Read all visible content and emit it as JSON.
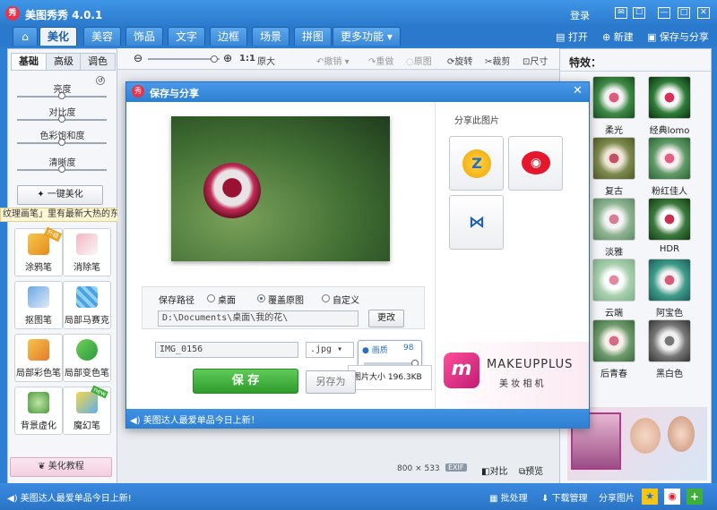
{
  "app": {
    "title": "美图秀秀 4.0.1",
    "logo_text": "秀",
    "login": "登录"
  },
  "window_controls": {
    "feedback": "✉",
    "menu": "☐",
    "minimize": "—",
    "maximize": "□",
    "close": "✕"
  },
  "tabs": [
    {
      "label": "⌂"
    },
    {
      "label": "美化"
    },
    {
      "label": "美容"
    },
    {
      "label": "饰品"
    },
    {
      "label": "文字"
    },
    {
      "label": "边框"
    },
    {
      "label": "场景"
    },
    {
      "label": "拼图"
    },
    {
      "label": "更多功能 ▾"
    }
  ],
  "top_actions": {
    "open": "打开",
    "new": "新建",
    "save_share": "保存与分享"
  },
  "left_panel": {
    "subtabs": [
      "基础",
      "高级",
      "调色"
    ],
    "sliders": [
      "亮度",
      "对比度",
      "色彩饱和度",
      "清晰度"
    ],
    "one_click": "一键美化",
    "marquee": "纹理画笔」里有最新大热的东北",
    "tools": [
      {
        "label": "涂鸦笔",
        "badge": "升级"
      },
      {
        "label": "消除笔",
        "badge": ""
      },
      {
        "label": "抠图笔",
        "badge": ""
      },
      {
        "label": "局部马赛克",
        "badge": ""
      },
      {
        "label": "局部彩色笔",
        "badge": ""
      },
      {
        "label": "局部变色笔",
        "badge": ""
      },
      {
        "label": "背景虚化",
        "badge": ""
      },
      {
        "label": "魔幻笔",
        "badge": "new"
      }
    ],
    "tutorial": "美化教程"
  },
  "toolbar": {
    "zoom_ratio": "1:1",
    "original_size": "原大",
    "undo": "撤销",
    "redo": "重做",
    "original": "原图",
    "rotate": "旋转",
    "crop": "裁剪",
    "resize": "尺寸"
  },
  "canvas_footer": {
    "size_w": "800",
    "times": "×",
    "size_h": "533",
    "exif": "EXIF",
    "compare": "对比",
    "preview": "预览"
  },
  "dialog": {
    "title": "保存与分享",
    "save_path_label": "保存路径",
    "path_options": [
      "桌面",
      "覆盖原图",
      "自定义"
    ],
    "selected_option": 1,
    "path_value": "D:\\Documents\\桌面\\我的花\\",
    "change_button": "更改",
    "filename": "IMG_0156",
    "format": ".jpg",
    "quality_label": "画质",
    "quality_value": "98",
    "quality_fraction": 0.98,
    "filesize_label": "图片大小",
    "filesize_value": "196.3KB",
    "save_button": "保 存",
    "save_as_button": "另存为",
    "share_title": "分享此图片",
    "promo_brand": "MAKEUPPLUS",
    "promo_sub": "美 妆 相 机",
    "footer_notice": "美图达人最爱单品今日上新！"
  },
  "right_panel": {
    "title": "特效：",
    "effects": [
      "柔光",
      "经典lomo",
      "复古",
      "粉红佳人",
      "淡雅",
      "HDR",
      "云端",
      "阿宝色",
      "后青春",
      "黑白色"
    ]
  },
  "status": {
    "notice": "美图达人最爱单品今日上新!",
    "batch": "批处理",
    "download": "下载管理",
    "share": "分享图片"
  },
  "colors": {
    "accent": "#2a79cc",
    "save_green": "#3fae3a",
    "promo_pink": "#e0307a"
  }
}
